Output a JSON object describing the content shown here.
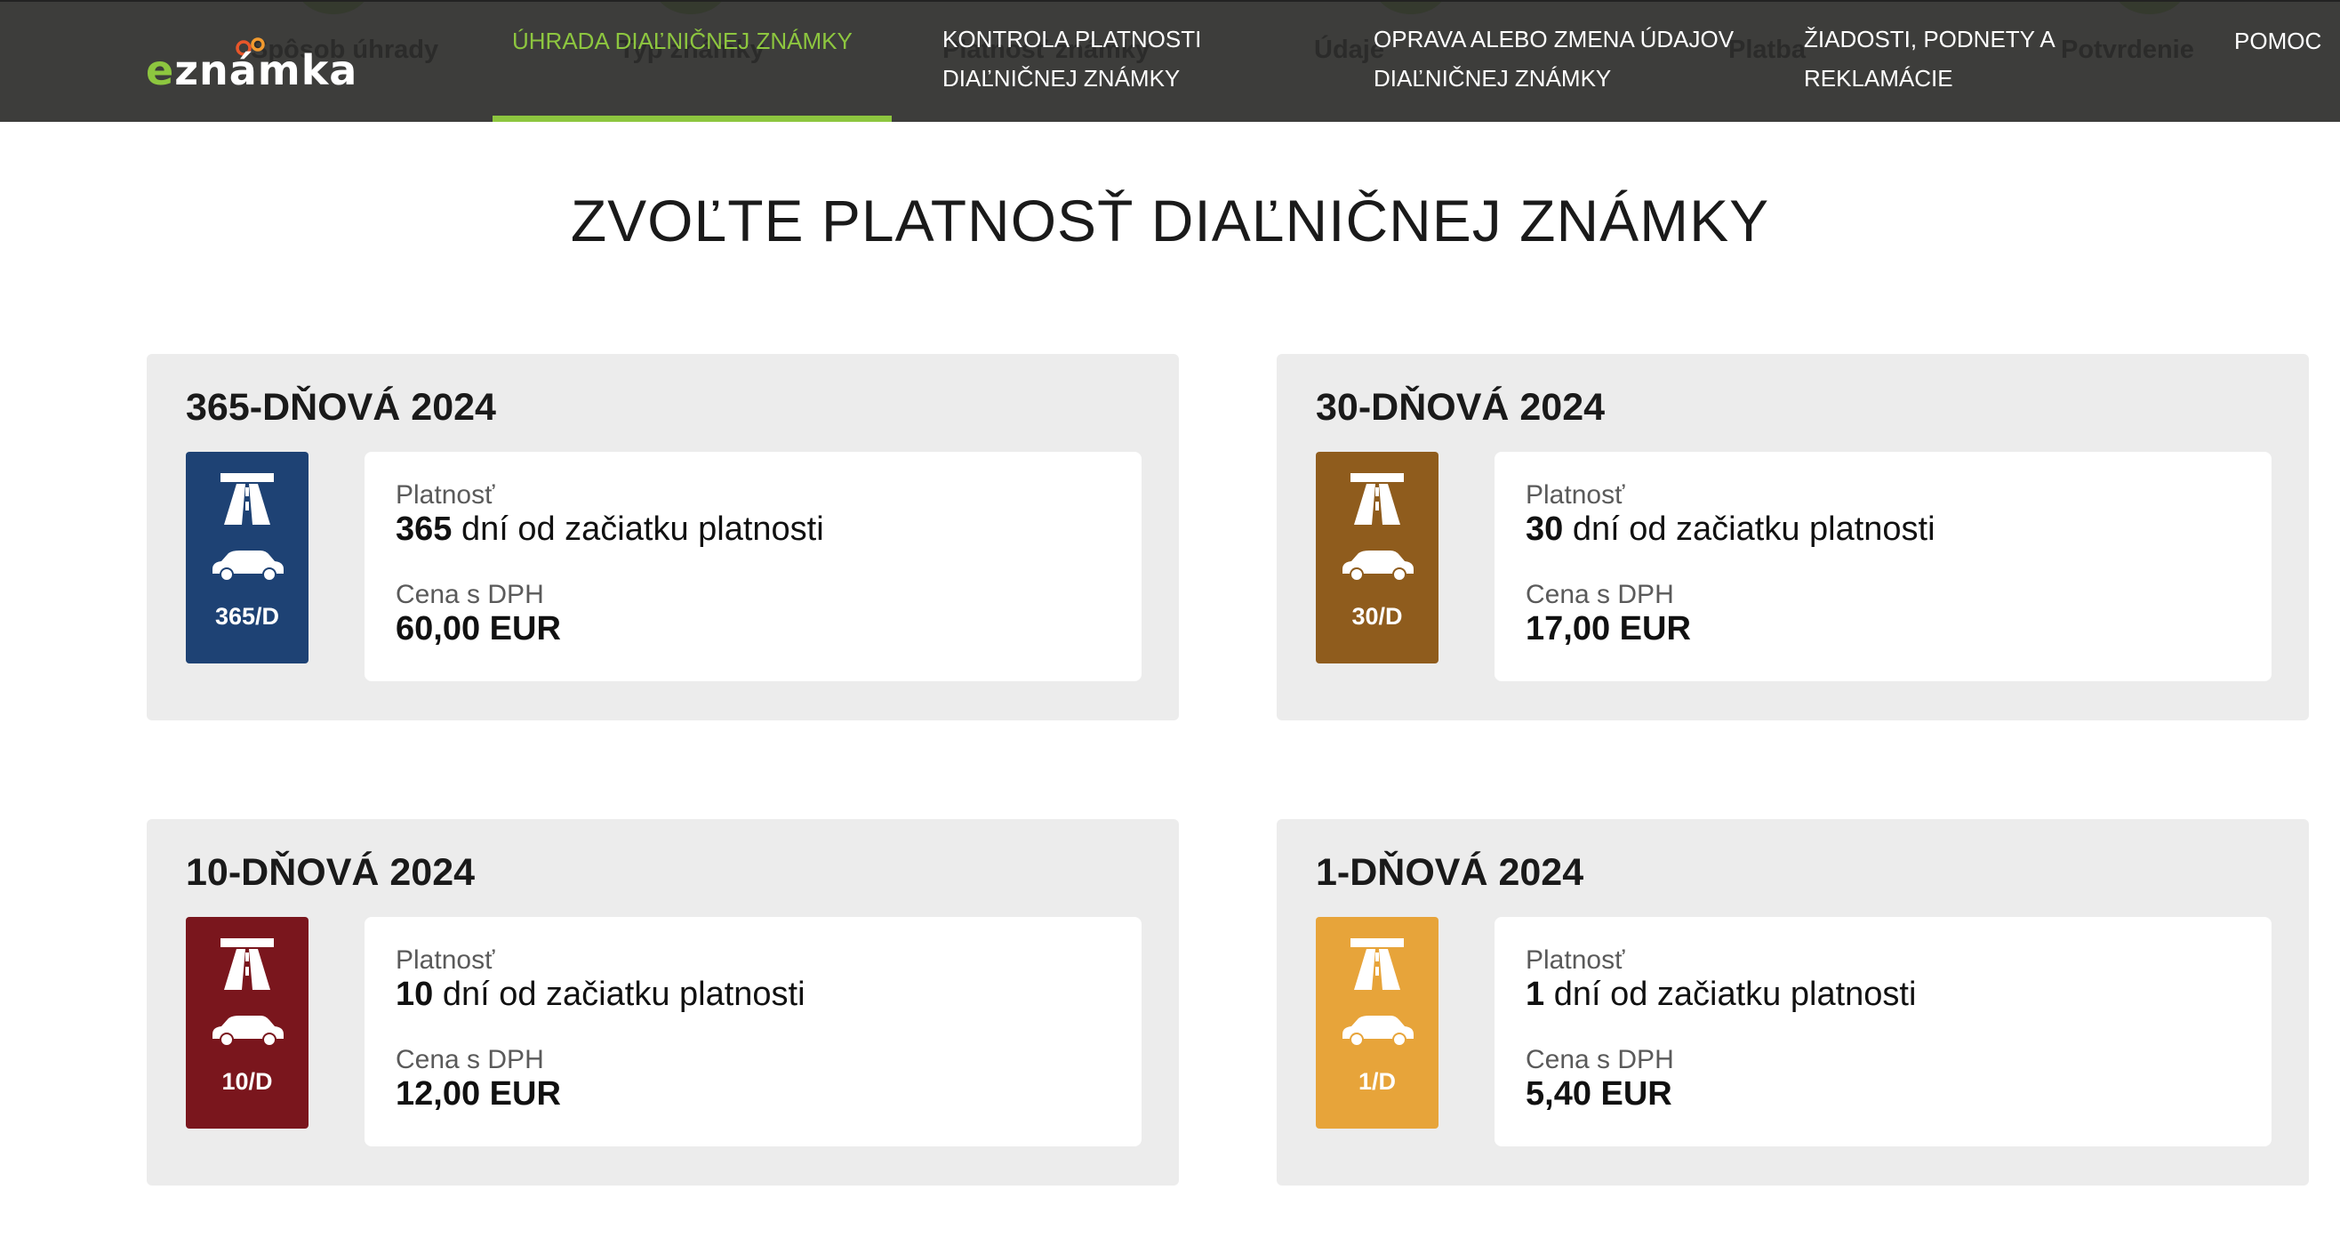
{
  "header": {
    "logo": {
      "prefix": "e",
      "rest": "známka"
    },
    "ghost_steps": [
      "Spôsob úhrady",
      "Typ známky",
      "Platnosť známky",
      "Údaje",
      "Platba",
      "Potvrdenie"
    ],
    "nav": [
      {
        "label": "ÚHRADA DIAĽNIČNEJ ZNÁMKY",
        "active": true
      },
      {
        "line1": "KONTROLA PLATNOSTI",
        "line2": "DIAĽNIČNEJ ZNÁMKY"
      },
      {
        "line1": "OPRAVA ALEBO ZMENA ÚDAJOV",
        "line2": "DIAĽNIČNEJ ZNÁMKY"
      },
      {
        "line1": "ŽIADOSTI, PODNETY A",
        "line2": "REKLAMÁCIE"
      },
      {
        "label": "POMOC"
      }
    ],
    "accent_color": "#8dc63f",
    "bar_color": "#3d3d3b"
  },
  "main": {
    "title": "ZVOĽTE PLATNOSŤ DIAĽNIČNEJ ZNÁMKY",
    "validity_label": "Platnosť",
    "validity_suffix": " dní od začiatku platnosti",
    "price_label": "Cena s DPH",
    "cards": [
      {
        "title": "365-DŇOVÁ 2024",
        "days": "365",
        "sticker_label": "365/D",
        "price": "60,00 EUR",
        "color": "#1e4274"
      },
      {
        "title": "30-DŇOVÁ 2024",
        "days": "30",
        "sticker_label": "30/D",
        "price": "17,00 EUR",
        "color": "#8f5c1d"
      },
      {
        "title": "10-DŇOVÁ 2024",
        "days": "10",
        "sticker_label": "10/D",
        "price": "12,00 EUR",
        "color": "#7a161d"
      },
      {
        "title": "1-DŇOVÁ 2024",
        "days": "1",
        "sticker_label": "1/D",
        "price": "5,40 EUR",
        "color": "#e7a43a"
      }
    ],
    "sticker_icons": [
      "motorway-icon",
      "car-icon"
    ]
  }
}
